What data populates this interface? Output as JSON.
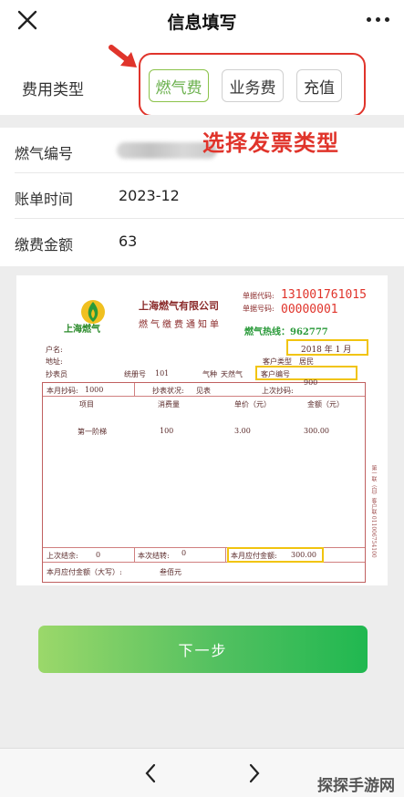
{
  "header": {
    "title": "信息填写",
    "close_icon": "close-icon",
    "more_icon": "more-icon"
  },
  "fee_type": {
    "label": "费用类型",
    "options": [
      {
        "label": "燃气费",
        "selected": true
      },
      {
        "label": "业务费",
        "selected": false
      },
      {
        "label": "充值",
        "selected": false
      }
    ],
    "annotation": "选择发票类型",
    "accent_color": "#e0342b",
    "selected_color": "#6ab04c"
  },
  "info": {
    "rows": [
      {
        "label": "燃气编号",
        "value": ""
      },
      {
        "label": "账单时间",
        "value": "2023-12"
      },
      {
        "label": "缴费金额",
        "value": "63"
      }
    ]
  },
  "bill": {
    "company": "上海燃气有限公司",
    "notice_title": "燃气缴费通知单",
    "logo_text": "上海燃气",
    "code_label_1": "单据代码:",
    "code_label_2": "单据号码:",
    "code_1": "131001761015",
    "code_2": "00000001",
    "hotline": "燃气热线：962777",
    "date": "2018 年 1 月",
    "account_label": "户名:",
    "address_label": "地址:",
    "reader_label": "抄表员",
    "book_label": "统册号",
    "book_no": "101",
    "gas_type_label": "气种",
    "gas_type": "天然气",
    "customer_type_label": "客户类型",
    "customer_type": "居民",
    "customer_no_label": "客户编号",
    "meter_this_label": "本月抄码:",
    "meter_this": "1000",
    "meter_status_label": "抄表状况:",
    "meter_status": "见表",
    "meter_last_label": "上次抄码:",
    "meter_last": "900",
    "columns": [
      "项目",
      "消费量",
      "单价（元）",
      "金额（元）"
    ],
    "item": {
      "name": "第一阶梯",
      "qty": "100",
      "price": "3.00",
      "amount": "300.00"
    },
    "last_balance_label": "上次结余:",
    "last_balance": "0",
    "this_balance_label": "本次结转:",
    "this_balance": "0",
    "due_label": "本月应付金额:",
    "due": "300.00",
    "due_caps_label": "本月应付金额（大写）:",
    "due_caps": "叁佰元",
    "side_text": "第一联（白）客户联  011006754100"
  },
  "next_label": "下一步",
  "bottom": {
    "back_icon": "chevron-left-icon",
    "forward_icon": "chevron-right-icon",
    "watermark": "探探手游网"
  }
}
